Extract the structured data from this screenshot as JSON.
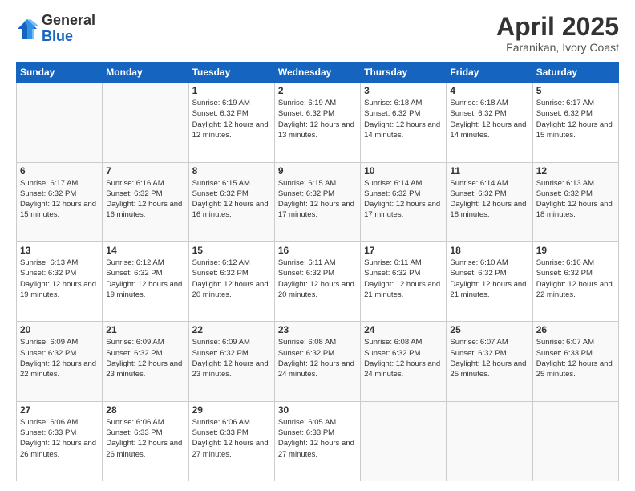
{
  "logo": {
    "general": "General",
    "blue": "Blue"
  },
  "header": {
    "title": "April 2025",
    "subtitle": "Faranikan, Ivory Coast"
  },
  "weekdays": [
    "Sunday",
    "Monday",
    "Tuesday",
    "Wednesday",
    "Thursday",
    "Friday",
    "Saturday"
  ],
  "weeks": [
    [
      {
        "day": "",
        "info": ""
      },
      {
        "day": "",
        "info": ""
      },
      {
        "day": "1",
        "info": "Sunrise: 6:19 AM\nSunset: 6:32 PM\nDaylight: 12 hours and 12 minutes."
      },
      {
        "day": "2",
        "info": "Sunrise: 6:19 AM\nSunset: 6:32 PM\nDaylight: 12 hours and 13 minutes."
      },
      {
        "day": "3",
        "info": "Sunrise: 6:18 AM\nSunset: 6:32 PM\nDaylight: 12 hours and 14 minutes."
      },
      {
        "day": "4",
        "info": "Sunrise: 6:18 AM\nSunset: 6:32 PM\nDaylight: 12 hours and 14 minutes."
      },
      {
        "day": "5",
        "info": "Sunrise: 6:17 AM\nSunset: 6:32 PM\nDaylight: 12 hours and 15 minutes."
      }
    ],
    [
      {
        "day": "6",
        "info": "Sunrise: 6:17 AM\nSunset: 6:32 PM\nDaylight: 12 hours and 15 minutes."
      },
      {
        "day": "7",
        "info": "Sunrise: 6:16 AM\nSunset: 6:32 PM\nDaylight: 12 hours and 16 minutes."
      },
      {
        "day": "8",
        "info": "Sunrise: 6:15 AM\nSunset: 6:32 PM\nDaylight: 12 hours and 16 minutes."
      },
      {
        "day": "9",
        "info": "Sunrise: 6:15 AM\nSunset: 6:32 PM\nDaylight: 12 hours and 17 minutes."
      },
      {
        "day": "10",
        "info": "Sunrise: 6:14 AM\nSunset: 6:32 PM\nDaylight: 12 hours and 17 minutes."
      },
      {
        "day": "11",
        "info": "Sunrise: 6:14 AM\nSunset: 6:32 PM\nDaylight: 12 hours and 18 minutes."
      },
      {
        "day": "12",
        "info": "Sunrise: 6:13 AM\nSunset: 6:32 PM\nDaylight: 12 hours and 18 minutes."
      }
    ],
    [
      {
        "day": "13",
        "info": "Sunrise: 6:13 AM\nSunset: 6:32 PM\nDaylight: 12 hours and 19 minutes."
      },
      {
        "day": "14",
        "info": "Sunrise: 6:12 AM\nSunset: 6:32 PM\nDaylight: 12 hours and 19 minutes."
      },
      {
        "day": "15",
        "info": "Sunrise: 6:12 AM\nSunset: 6:32 PM\nDaylight: 12 hours and 20 minutes."
      },
      {
        "day": "16",
        "info": "Sunrise: 6:11 AM\nSunset: 6:32 PM\nDaylight: 12 hours and 20 minutes."
      },
      {
        "day": "17",
        "info": "Sunrise: 6:11 AM\nSunset: 6:32 PM\nDaylight: 12 hours and 21 minutes."
      },
      {
        "day": "18",
        "info": "Sunrise: 6:10 AM\nSunset: 6:32 PM\nDaylight: 12 hours and 21 minutes."
      },
      {
        "day": "19",
        "info": "Sunrise: 6:10 AM\nSunset: 6:32 PM\nDaylight: 12 hours and 22 minutes."
      }
    ],
    [
      {
        "day": "20",
        "info": "Sunrise: 6:09 AM\nSunset: 6:32 PM\nDaylight: 12 hours and 22 minutes."
      },
      {
        "day": "21",
        "info": "Sunrise: 6:09 AM\nSunset: 6:32 PM\nDaylight: 12 hours and 23 minutes."
      },
      {
        "day": "22",
        "info": "Sunrise: 6:09 AM\nSunset: 6:32 PM\nDaylight: 12 hours and 23 minutes."
      },
      {
        "day": "23",
        "info": "Sunrise: 6:08 AM\nSunset: 6:32 PM\nDaylight: 12 hours and 24 minutes."
      },
      {
        "day": "24",
        "info": "Sunrise: 6:08 AM\nSunset: 6:32 PM\nDaylight: 12 hours and 24 minutes."
      },
      {
        "day": "25",
        "info": "Sunrise: 6:07 AM\nSunset: 6:32 PM\nDaylight: 12 hours and 25 minutes."
      },
      {
        "day": "26",
        "info": "Sunrise: 6:07 AM\nSunset: 6:33 PM\nDaylight: 12 hours and 25 minutes."
      }
    ],
    [
      {
        "day": "27",
        "info": "Sunrise: 6:06 AM\nSunset: 6:33 PM\nDaylight: 12 hours and 26 minutes."
      },
      {
        "day": "28",
        "info": "Sunrise: 6:06 AM\nSunset: 6:33 PM\nDaylight: 12 hours and 26 minutes."
      },
      {
        "day": "29",
        "info": "Sunrise: 6:06 AM\nSunset: 6:33 PM\nDaylight: 12 hours and 27 minutes."
      },
      {
        "day": "30",
        "info": "Sunrise: 6:05 AM\nSunset: 6:33 PM\nDaylight: 12 hours and 27 minutes."
      },
      {
        "day": "",
        "info": ""
      },
      {
        "day": "",
        "info": ""
      },
      {
        "day": "",
        "info": ""
      }
    ]
  ]
}
